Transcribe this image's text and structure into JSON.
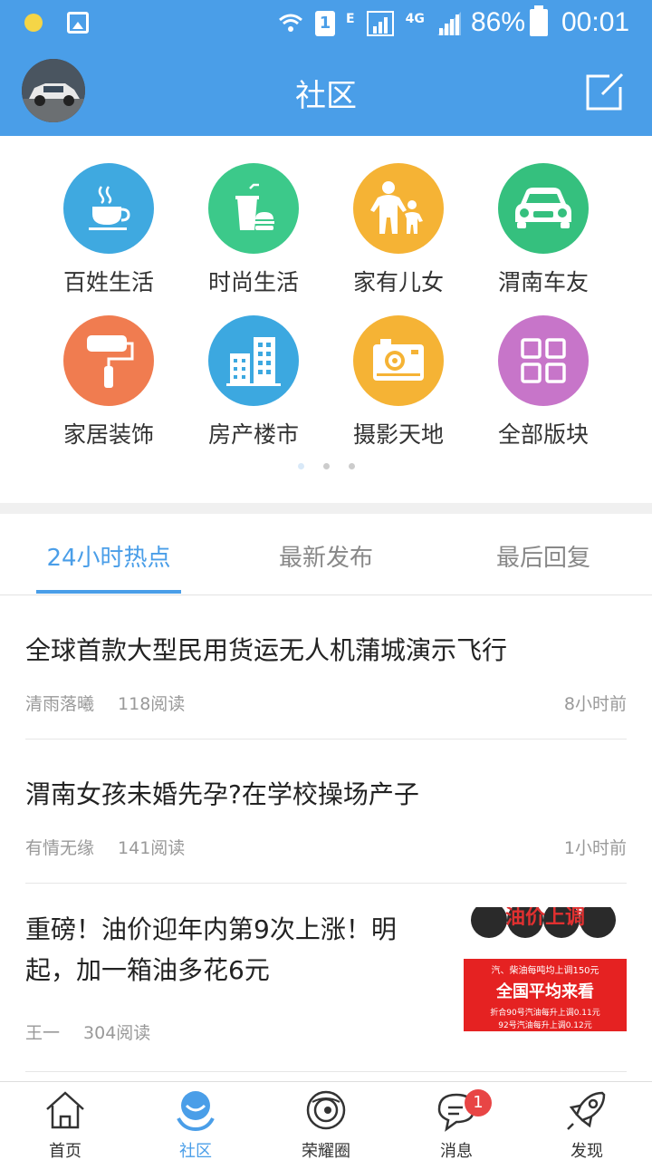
{
  "status_bar": {
    "sim_label": "1",
    "network_e": "E",
    "network_4g": "4G",
    "battery": "86%",
    "time": "00:01"
  },
  "header": {
    "title": "社区",
    "avatar_icon": "car-avatar",
    "compose_icon": "compose-icon"
  },
  "categories": [
    {
      "label": "百姓生活",
      "icon": "coffee-icon",
      "color": "#3fa9e0"
    },
    {
      "label": "时尚生活",
      "icon": "drink-burger-icon",
      "color": "#3cc98a"
    },
    {
      "label": "家有儿女",
      "icon": "parent-child-icon",
      "color": "#f5b335"
    },
    {
      "label": "渭南车友",
      "icon": "car-icon",
      "color": "#35c07e"
    },
    {
      "label": "家居装饰",
      "icon": "paint-roller-icon",
      "color": "#f07c50"
    },
    {
      "label": "房产楼市",
      "icon": "buildings-icon",
      "color": "#3ca8e0"
    },
    {
      "label": "摄影天地",
      "icon": "camera-icon",
      "color": "#f5b335"
    },
    {
      "label": "全部版块",
      "icon": "grid-icon",
      "color": "#c775c9"
    }
  ],
  "tabs": [
    {
      "label": "24小时热点",
      "active": true
    },
    {
      "label": "最新发布",
      "active": false
    },
    {
      "label": "最后回复",
      "active": false
    }
  ],
  "posts": [
    {
      "title": "全球首款大型民用货运无人机蒲城演示飞行",
      "author": "清雨落曦",
      "reads": "118阅读",
      "time": "8小时前"
    },
    {
      "title": "渭南女孩未婚先孕?在学校操场产子",
      "author": "有情无缘",
      "reads": "141阅读",
      "time": "1小时前"
    },
    {
      "title": "重磅！油价迎年内第9次上涨！明起，加一箱油多花6元",
      "author": "王一",
      "reads": "304阅读",
      "time": "",
      "thumb": {
        "banner": "油价上调",
        "line1": "汽、柴油每吨均上调150元",
        "line2": "全国平均来看",
        "line3": "折合90号汽油每升上调0.11元",
        "line4": "92号汽油每升上调0.12元"
      }
    }
  ],
  "bottom_nav": [
    {
      "label": "首页",
      "icon": "home-icon",
      "active": false
    },
    {
      "label": "社区",
      "icon": "community-icon",
      "active": true
    },
    {
      "label": "荣耀圈",
      "icon": "planet-icon",
      "active": false
    },
    {
      "label": "消息",
      "icon": "message-icon",
      "active": false,
      "badge": "1"
    },
    {
      "label": "发现",
      "icon": "rocket-icon",
      "active": false
    }
  ]
}
